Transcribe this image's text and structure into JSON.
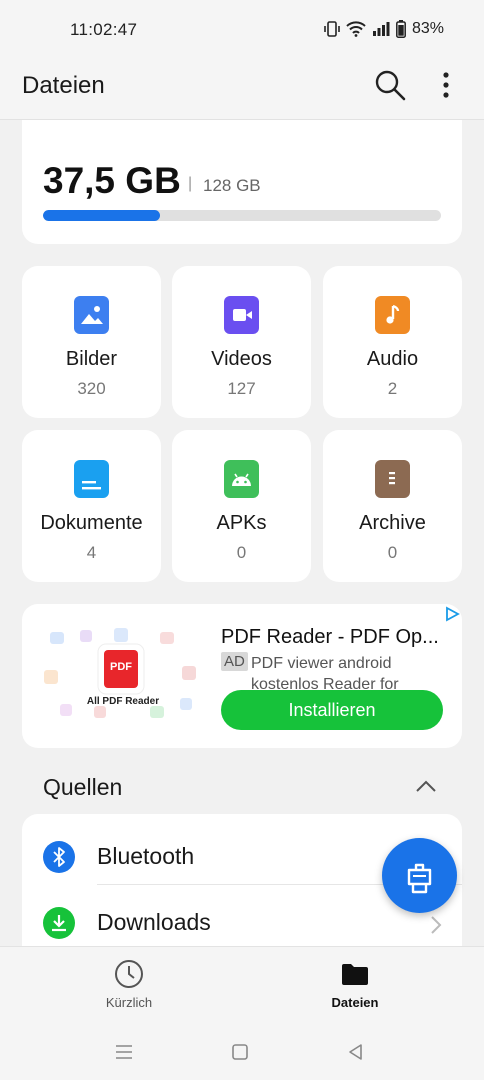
{
  "status_bar": {
    "time": "11:02:47",
    "battery": "83%"
  },
  "app_bar": {
    "title": "Dateien"
  },
  "storage": {
    "used": "37,5 GB",
    "separator": "|",
    "total": "128 GB",
    "used_fraction": 0.293
  },
  "categories": [
    {
      "name": "Bilder",
      "count": "320",
      "icon": "image-icon",
      "color": "#3d7ff0"
    },
    {
      "name": "Videos",
      "count": "127",
      "icon": "video-icon",
      "color": "#6a4ff0"
    },
    {
      "name": "Audio",
      "count": "2",
      "icon": "music-icon",
      "color": "#f08a24"
    },
    {
      "name": "Dokumente",
      "count": "4",
      "icon": "document-icon",
      "color": "#1aa0f0"
    },
    {
      "name": "APKs",
      "count": "0",
      "icon": "android-icon",
      "color": "#3fbf5a"
    },
    {
      "name": "Archive",
      "count": "0",
      "icon": "archive-icon",
      "color": "#8c6a52"
    }
  ],
  "ad": {
    "title": "PDF Reader - PDF Op...",
    "badge": "AD",
    "description": "PDF viewer android kostenlos Reader for epu...",
    "art_label": "All PDF Reader",
    "art_icon_text": "PDF",
    "button": "Installieren"
  },
  "sources": {
    "title": "Quellen",
    "items": [
      {
        "label": "Bluetooth",
        "icon": "bluetooth-icon",
        "color": "#1a73e8"
      },
      {
        "label": "Downloads",
        "icon": "download-icon",
        "color": "#16c23a"
      }
    ]
  },
  "bottom_nav": {
    "items": [
      {
        "label": "Kürzlich",
        "icon": "clock-icon",
        "active": false
      },
      {
        "label": "Dateien",
        "icon": "folder-icon",
        "active": true
      }
    ]
  }
}
